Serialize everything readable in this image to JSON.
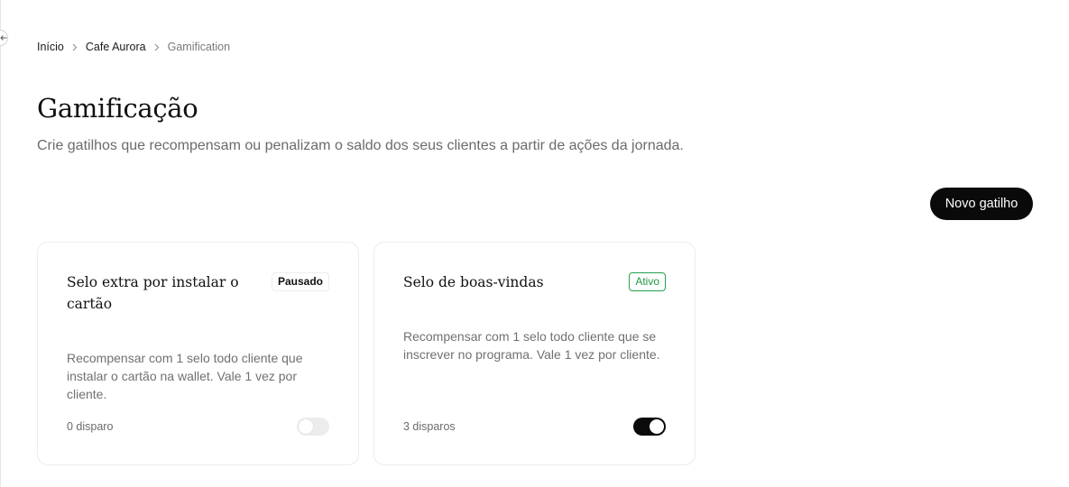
{
  "breadcrumb": {
    "items": [
      {
        "label": "Início"
      },
      {
        "label": "Cafe Aurora"
      },
      {
        "label": "Gamification"
      }
    ]
  },
  "header": {
    "title": "Gamificação",
    "subtitle": "Crie gatilhos que recompensam ou penalizam o saldo dos seus clientes a partir de ações da jornada."
  },
  "actions": {
    "new_trigger_label": "Novo gatilho"
  },
  "triggers": [
    {
      "title": "Selo extra por instalar o cartão",
      "status": "Pausado",
      "description": "Recompensar com 1 selo todo cliente que instalar o cartão na wallet. Vale 1 vez por cliente.",
      "fires": "0 disparo",
      "enabled": false
    },
    {
      "title": "Selo de boas-vindas",
      "status": "Ativo",
      "description": "Recompensar com 1 selo todo cliente que se inscrever no programa. Vale 1 vez por cliente.",
      "fires": "3 disparos",
      "enabled": true
    }
  ],
  "colors": {
    "primary": "#0a0a0a",
    "active_badge": "#22a14a",
    "muted_text": "#6b6b6b"
  },
  "icons": {
    "collapse": "arrow-left-icon",
    "separator": "chevron-right-icon"
  }
}
